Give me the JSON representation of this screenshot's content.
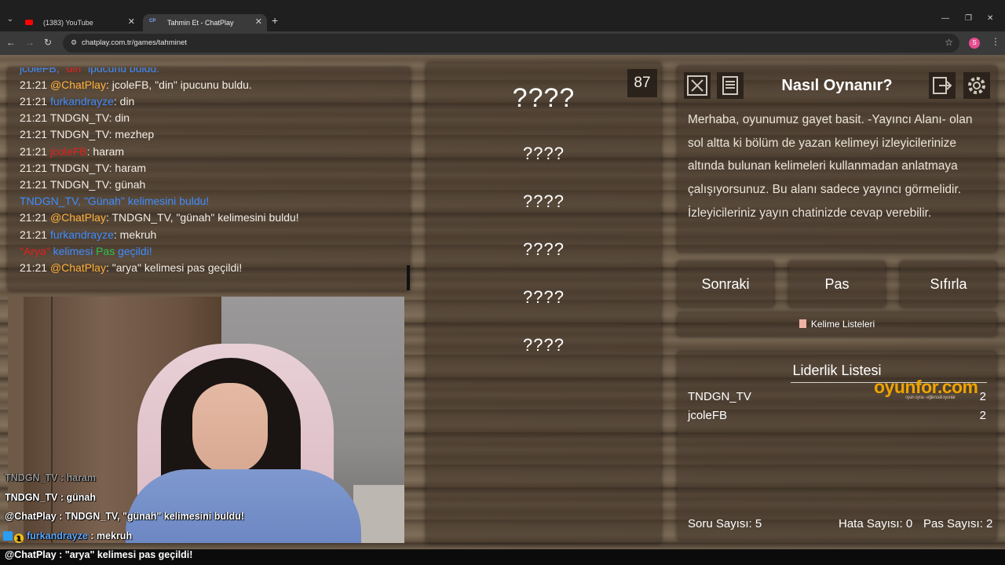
{
  "browser": {
    "tabs": [
      {
        "title": "(1383) YouTube",
        "active": false
      },
      {
        "title": "Tahmin Et - ChatPlay",
        "active": true
      }
    ],
    "url": "chatplay.com.tr/games/tahminet",
    "profile_initial": "S"
  },
  "chat": {
    "top_partial": {
      "user": "jcoleFB",
      "middle": "\"din\"",
      "text": " ipucunu buldu."
    },
    "lines": [
      {
        "time": "21:21",
        "user": "@ChatPlay",
        "text": "jcoleFB, \"din\" ipucunu buldu."
      },
      {
        "time": "21:21",
        "user": "furkandrayze",
        "text": "din"
      },
      {
        "time": "21:21",
        "user": "TNDGN_TV",
        "text": "din"
      },
      {
        "time": "21:21",
        "user": "TNDGN_TV",
        "text": "mezhep"
      },
      {
        "time": "21:21",
        "user": "jcoleFB",
        "text": "haram"
      },
      {
        "time": "21:21",
        "user": "TNDGN_TV",
        "text": "haram"
      },
      {
        "time": "21:21",
        "user": "TNDGN_TV",
        "text": "günah"
      },
      {
        "time": "",
        "user": "TNDGN_TV",
        "text": "\"Günah\" kelimesini buldu!"
      },
      {
        "time": "21:21",
        "user": "@ChatPlay",
        "text": "TNDGN_TV, \"günah\" kelimesini buldu!"
      },
      {
        "time": "21:21",
        "user": "furkandrayze",
        "text": "mekruh"
      },
      {
        "time": "",
        "user": "\"Arya\"",
        "text": "kelimesi Pas geçildi!"
      },
      {
        "time": "21:21",
        "user": "@ChatPlay",
        "text": "\"arya\" kelimesi pas geçildi!"
      }
    ]
  },
  "stream_overlay": {
    "lines": [
      {
        "user": "TNDGN_TV",
        "text": " : haram"
      },
      {
        "user": "TNDGN_TV",
        "text": " : günah"
      },
      {
        "user": "@ChatPlay",
        "text": " : TNDGN_TV, \"günah\" kelimesini buldu!"
      },
      {
        "user": "furkandrayze",
        "text": " : mekruh"
      },
      {
        "user": "@ChatPlay",
        "text": " : \"arya\" kelimesi pas geçildi!"
      }
    ]
  },
  "game": {
    "timer": "87",
    "main_word": "????",
    "hidden_words": [
      "????",
      "????",
      "????",
      "????",
      "????"
    ]
  },
  "howto": {
    "title": "Nasıl Oynanır?",
    "text": "Merhaba, oyunumuz gayet basit. -Yayıncı Alanı- olan sol altta ki bölüm de yazan kelimeyi izleyicilerinize altında bulunan kelimeleri kullanmadan anlatmaya çalışıyorsunuz. Bu alanı sadece yayıncı görmelidir. İzleyicileriniz yayın chatinizde cevap verebilir."
  },
  "controls": {
    "next": "Sonraki",
    "pass": "Pas",
    "reset": "Sıfırla",
    "word_lists": "Kelime Listeleri"
  },
  "leaderboard": {
    "title": "Liderlik Listesi",
    "watermark": "oyunfor.com",
    "watermark_sub": "oyun oyna - eğlenceli oyunlar",
    "rows": [
      {
        "name": "TNDGN_TV",
        "score": "2"
      },
      {
        "name": "jcoleFB",
        "score": "2"
      }
    ],
    "stats": {
      "questions_label": "Soru Sayısı:",
      "questions": "5",
      "errors_label": "Hata Sayısı:",
      "errors": "0",
      "passes_label": "Pas Sayısı:",
      "passes": "2"
    }
  },
  "colors": {
    "user_blue": "#3f8cff",
    "chatplay_orange": "#ffb13b",
    "user_red": "#e02020",
    "pass_green": "#2fc24a"
  }
}
